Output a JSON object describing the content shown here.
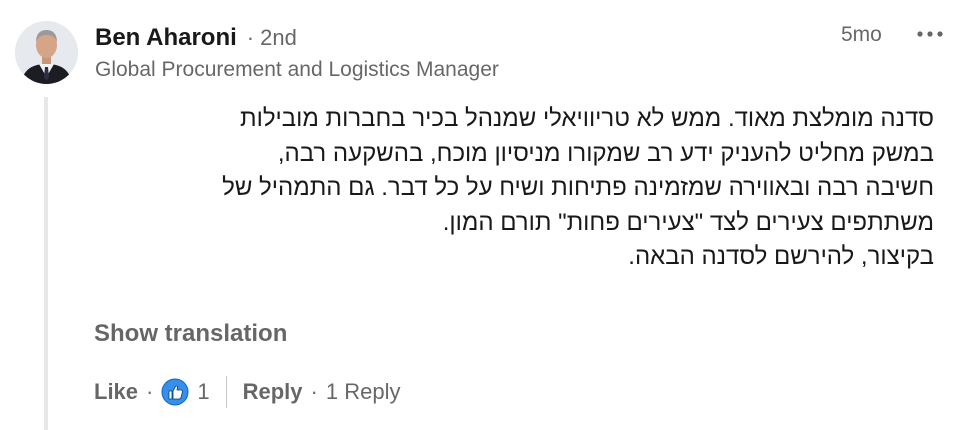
{
  "author": {
    "name": "Ben Aharoni",
    "degree": "2nd",
    "headline": "Global Procurement and Logistics Manager"
  },
  "timestamp": "5mo",
  "more_icon": "ellipsis-icon",
  "body_lines": [
    "סדנה מומלצת מאוד. ממש לא טריוויאלי שמנהל בכיר בחברות מובילות",
    "במשק מחליט להעניק ידע רב שמקורו מניסיון מוכח, בהשקעה רבה,",
    "חשיבה רבה ובאווירה שמזמינה פתיחות ושיח על כל דבר. גם התמהיל של",
    "משתתפים צעירים לצד \"צעירים פחות\" תורם המון.",
    "בקיצור, להירשם לסדנה הבאה."
  ],
  "show_translation": "Show translation",
  "actions": {
    "like_label": "Like",
    "like_icon": "thumbs-up-icon",
    "like_count": "1",
    "reply_label": "Reply",
    "reply_count": "1 Reply",
    "separator": "·"
  },
  "colors": {
    "like_blue": "#378fe9",
    "like_outline": "#0a66c2",
    "muted_text": "#666666",
    "thread_line": "#e8e8e8"
  }
}
